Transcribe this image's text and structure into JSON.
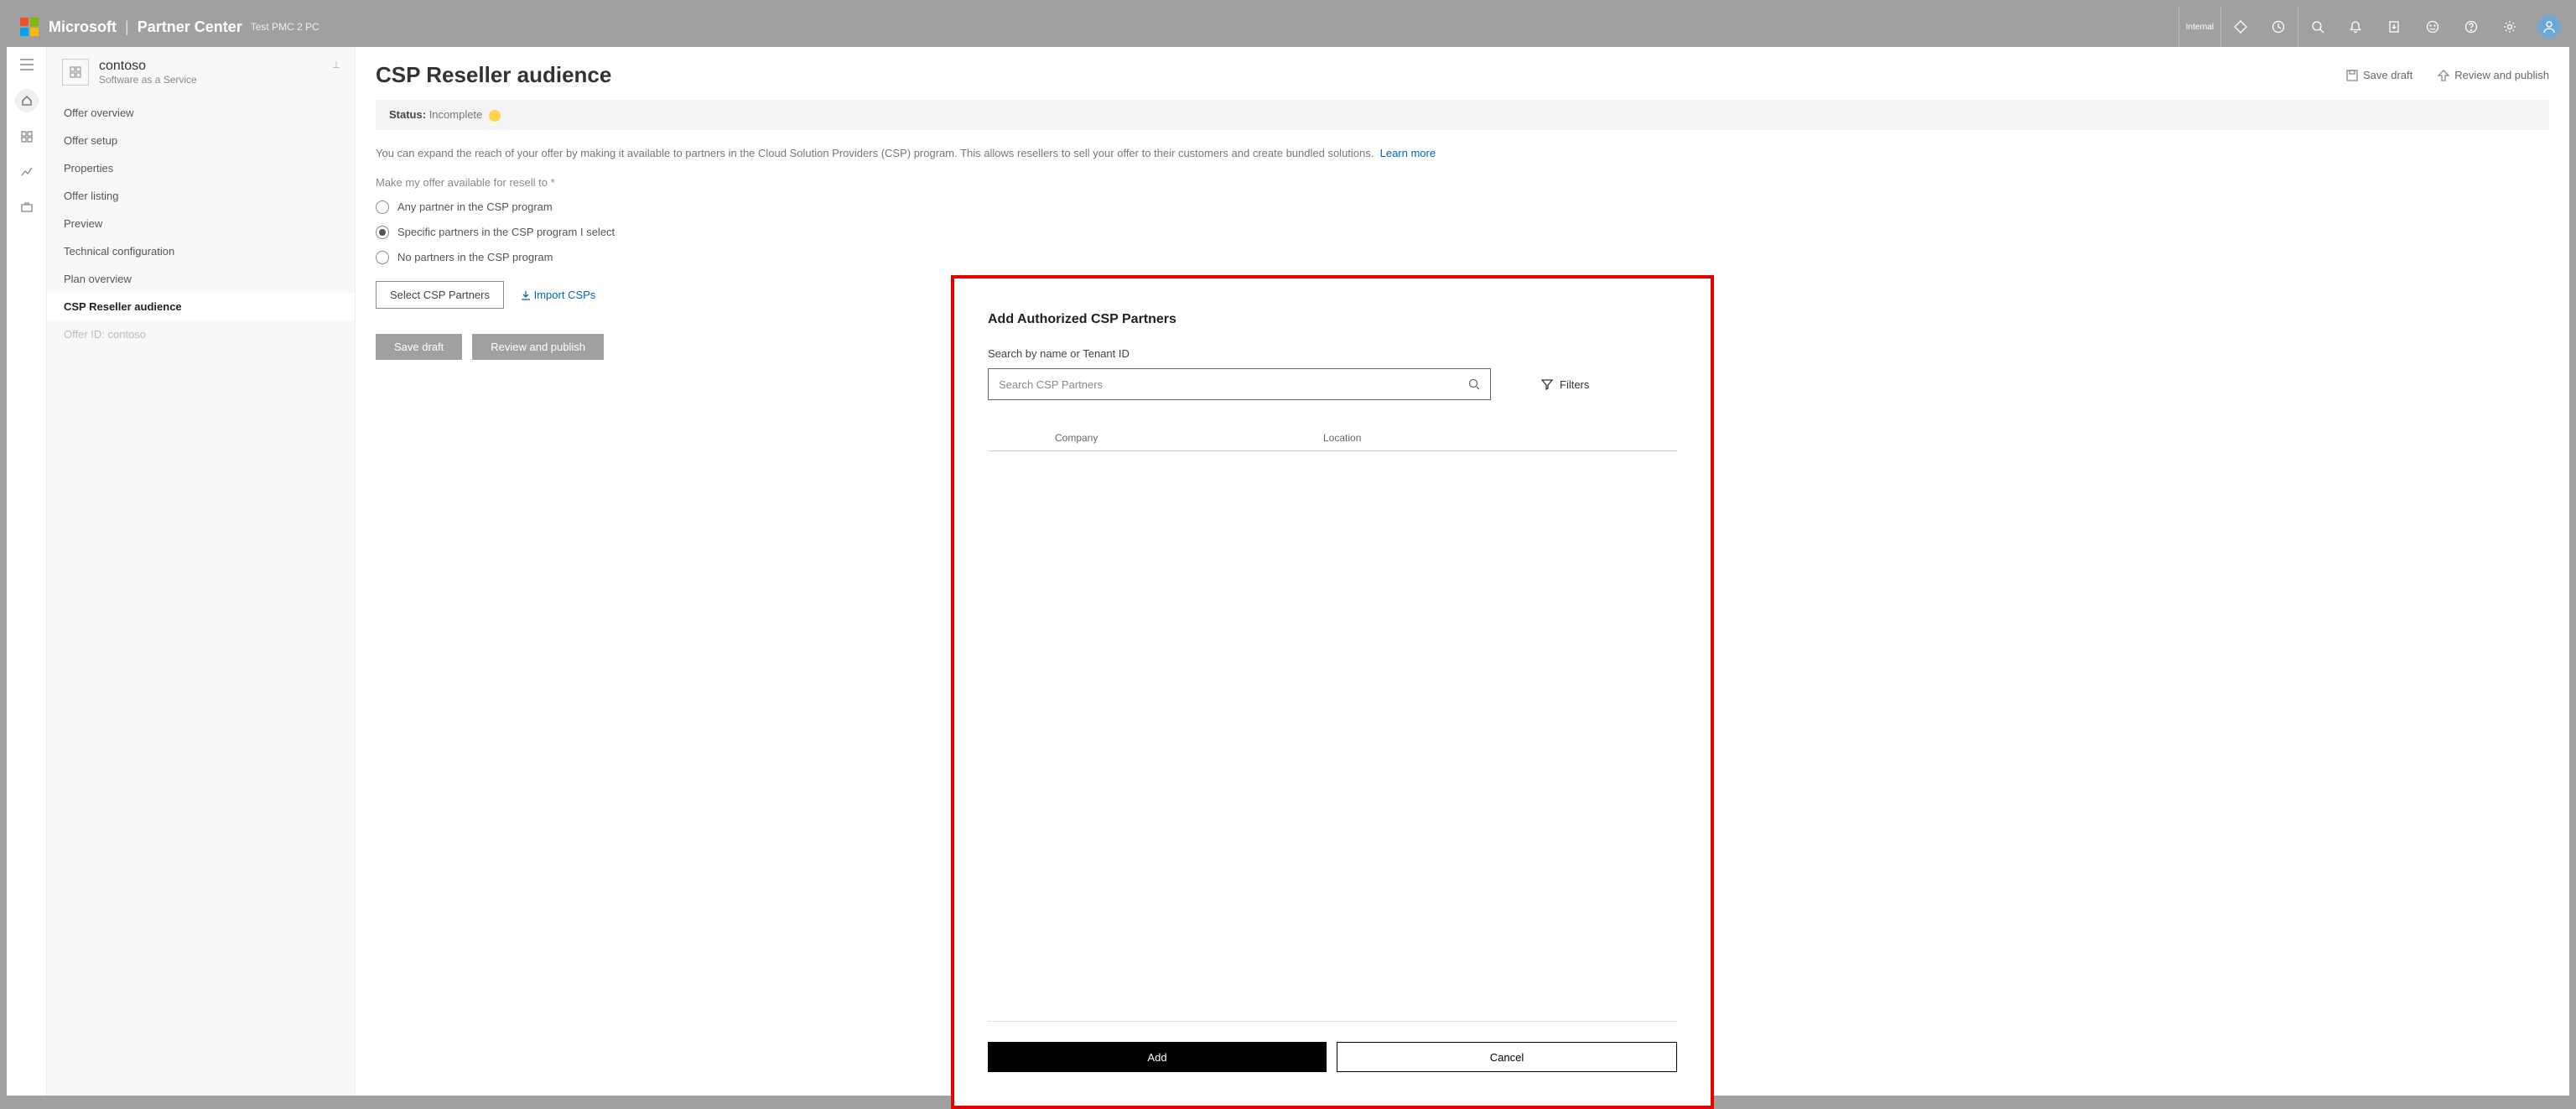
{
  "topbar": {
    "brand": "Microsoft",
    "product": "Partner Center",
    "env": "Test PMC 2 PC",
    "badge": "Internal"
  },
  "sidebar": {
    "title": "contoso",
    "subtitle": "Software as a Service",
    "items": [
      "Offer overview",
      "Offer setup",
      "Properties",
      "Offer listing",
      "Preview",
      "Technical configuration",
      "Plan overview",
      "CSP Reseller audience"
    ],
    "disabled_item": "Offer ID: contoso"
  },
  "page": {
    "title": "CSP Reseller audience",
    "save_draft": "Save draft",
    "review_publish": "Review and publish",
    "status_label": "Status:",
    "status_value": "Incomplete",
    "description": "You can expand the reach of your offer by making it available to partners in the Cloud Solution Providers (CSP) program. This allows resellers to sell your offer to their customers and create bundled solutions.",
    "learn_more": "Learn more",
    "form_label": "Make my offer available for resell to *",
    "radios": [
      "Any partner in the CSP program",
      "Specific partners in the CSP program I select",
      "No partners in the CSP program"
    ],
    "select_btn": "Select CSP Partners",
    "import_link": "Import CSPs",
    "save_btn": "Save draft",
    "review_btn": "Review and publish"
  },
  "dialog": {
    "title": "Add Authorized CSP Partners",
    "search_label": "Search by name or Tenant ID",
    "search_placeholder": "Search CSP Partners",
    "filters": "Filters",
    "cols": {
      "company": "Company",
      "location": "Location"
    },
    "add": "Add",
    "cancel": "Cancel"
  }
}
